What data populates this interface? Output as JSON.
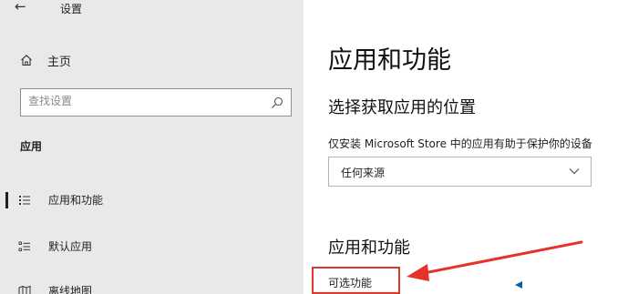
{
  "window": {
    "back_icon": "arrow-left-icon",
    "title": "设置"
  },
  "nav": {
    "home": {
      "icon": "home-icon",
      "label": "主页"
    },
    "search": {
      "placeholder": "查找设置",
      "icon": "search-icon"
    },
    "section_heading": "应用",
    "items": [
      {
        "icon": "apps-list-icon",
        "label": "应用和功能",
        "selected": true
      },
      {
        "icon": "default-apps-icon",
        "label": "默认应用",
        "selected": false
      },
      {
        "icon": "map-icon",
        "label": "离线地图",
        "selected": false
      }
    ]
  },
  "content": {
    "title": "应用和功能",
    "install_source": {
      "heading": "选择获取应用的位置",
      "description": "仅安装 Microsoft Store 中的应用有助于保护你的设备",
      "dropdown_value": "任何来源",
      "dropdown_icon": "chevron-down-icon"
    },
    "apps_section": {
      "heading": "应用和功能",
      "optional_features_link": "可选功能"
    }
  },
  "colors": {
    "nav_background": "#e9e9e9",
    "content_background": "#ffffff",
    "annotation_red": "#e5322b",
    "accent_blue": "#0063b1"
  }
}
